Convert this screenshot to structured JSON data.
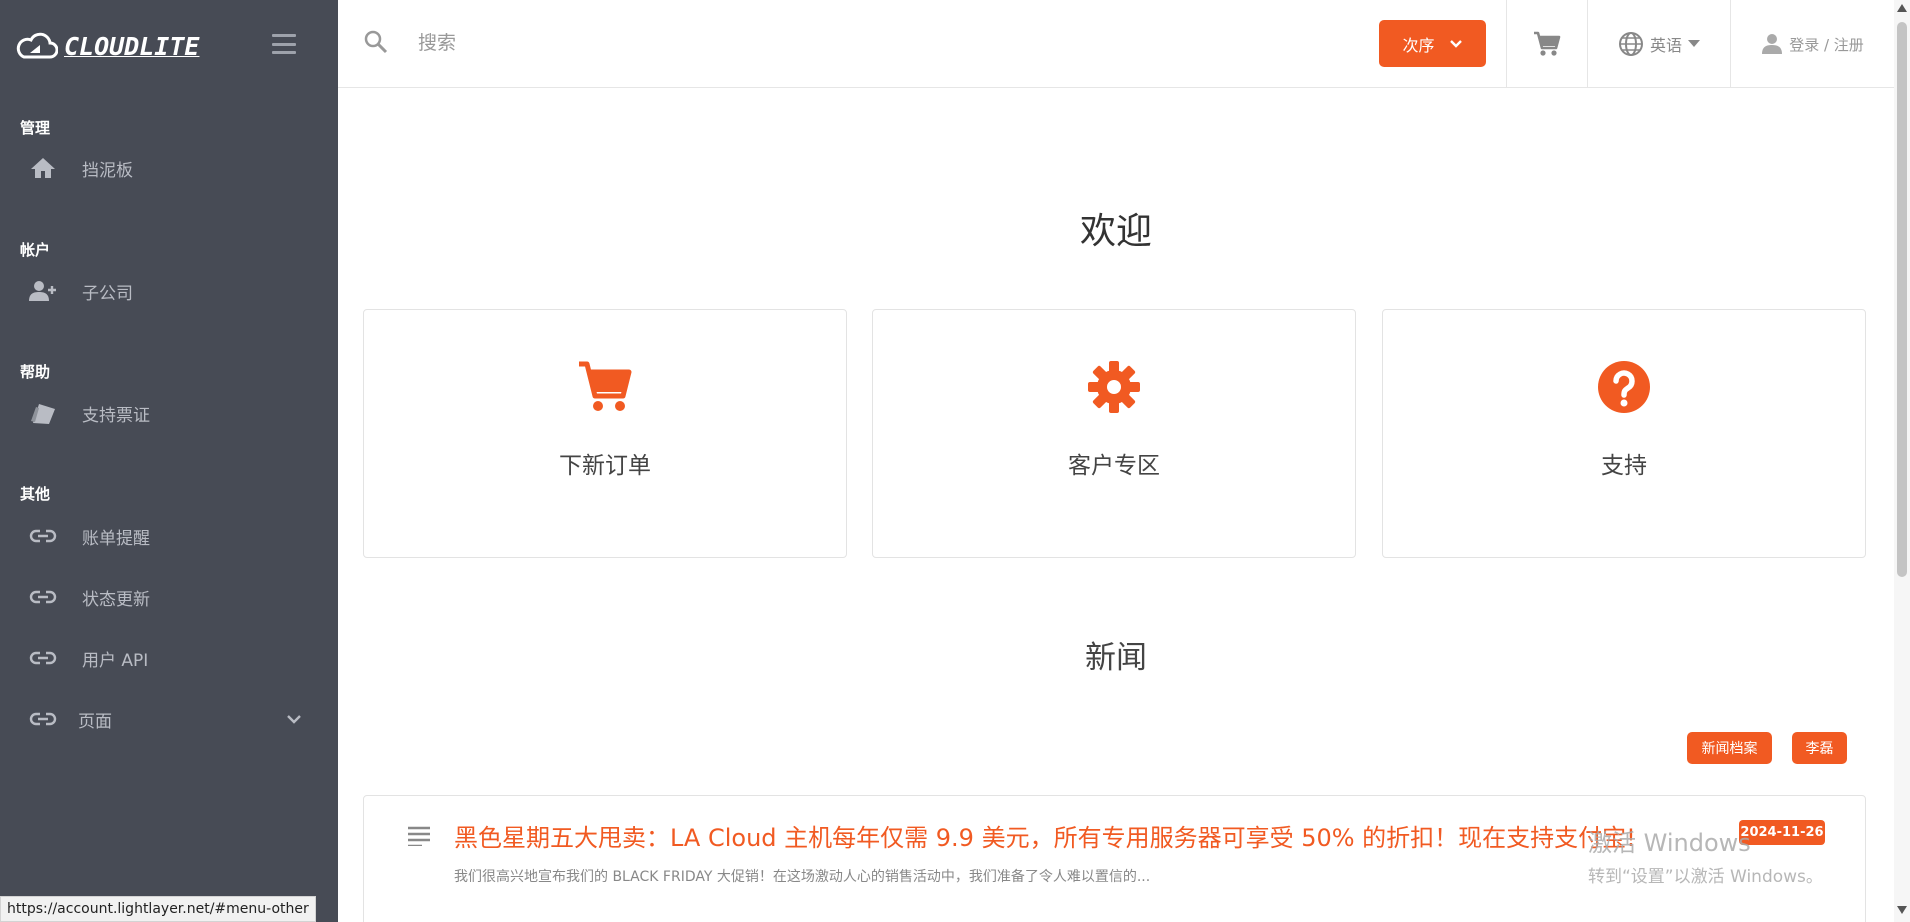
{
  "brand": {
    "name": "CLOUDLITE"
  },
  "sidebar": {
    "sections": [
      {
        "title": "管理",
        "items": [
          {
            "label": "挡泥板",
            "icon": "home-icon"
          }
        ]
      },
      {
        "title": "帐户",
        "items": [
          {
            "label": "子公司",
            "icon": "user-plus-icon"
          }
        ]
      },
      {
        "title": "帮助",
        "items": [
          {
            "label": "支持票证",
            "icon": "ticket-icon"
          }
        ]
      },
      {
        "title": "其他",
        "items": [
          {
            "label": "账单提醒",
            "icon": "link-icon"
          },
          {
            "label": "状态更新",
            "icon": "link-icon"
          },
          {
            "label": "用户 API",
            "icon": "link-icon"
          },
          {
            "label": "页面",
            "icon": "link-icon"
          }
        ]
      }
    ]
  },
  "topbar": {
    "search_placeholder": "搜索",
    "order_label": "次序",
    "language_label": "英语",
    "login_label": "登录 / 注册"
  },
  "main": {
    "welcome_title": "欢迎",
    "cards": [
      {
        "label": "下新订单",
        "icon": "cart-icon"
      },
      {
        "label": "客户专区",
        "icon": "gear-icon"
      },
      {
        "label": "支持",
        "icon": "help-icon"
      }
    ],
    "news_title": "新闻",
    "news_archive_label": "新闻档案",
    "news_author_label": "李磊",
    "news": [
      {
        "title": "黑色星期五大甩卖：LA Cloud 主机每年仅需 9.9 美元，所有专用服务器可享受 50% 的折扣！现在支持支付宝!",
        "summary": "我们很高兴地宣布我们的 BLACK FRIDAY 大促销！在这场激动人心的销售活动中，我们准备了令人难以置信的...",
        "date": "2024-11-26"
      }
    ]
  },
  "status_bar": {
    "url": "https://account.lightlayer.net/#menu-other"
  },
  "watermark": {
    "line1": "激活 Windows",
    "line2": "转到“设置”以激活 Windows。"
  },
  "colors": {
    "accent": "#f15a22",
    "sidebar_bg": "#474b55"
  }
}
